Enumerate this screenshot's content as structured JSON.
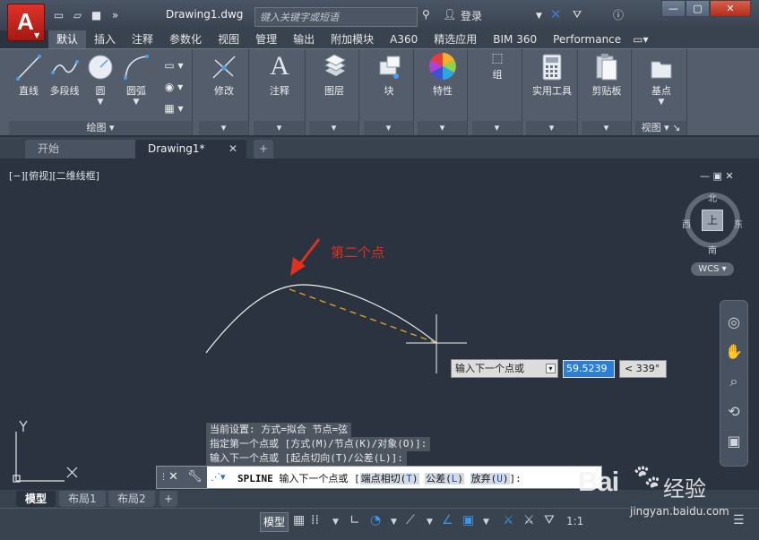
{
  "titlebar": {
    "document_title": "Drawing1.dwg",
    "search_placeholder": "键入关键字或短语",
    "signin_label": "登录"
  },
  "ribbon_tabs": [
    "默认",
    "插入",
    "注释",
    "参数化",
    "视图",
    "管理",
    "输出",
    "附加模块",
    "A360",
    "精选应用",
    "BIM 360",
    "Performance"
  ],
  "draw_panel": {
    "footer": "绘图",
    "tools": {
      "line": "直线",
      "polyline": "多段线",
      "circle": "圆",
      "arc": "圆弧"
    }
  },
  "panels": {
    "modify": "修改",
    "annotation": "注释",
    "layers": "图层",
    "block": "块",
    "properties": "特性",
    "groups": "组",
    "utilities": "实用工具",
    "clipboard": "剪贴板",
    "view": "视图",
    "basepoint": "基点"
  },
  "file_tabs": {
    "start": "开始",
    "drawing": "Drawing1*"
  },
  "viewport": {
    "label": "[−][俯视][二维线框]",
    "viewcube": {
      "face": "上",
      "north": "北",
      "south": "南",
      "east": "东",
      "west": "西"
    },
    "wcs": "WCS",
    "annotation_text": "第二个点"
  },
  "dynamic_input": {
    "prompt": "输入下一个点或",
    "distance_value": "59.5239",
    "angle_value": "< 339°"
  },
  "command_history": [
    "当前设置: 方式=拟合   节点=弦",
    "指定第一个点或 [方式(M)/节点(K)/对象(O)]:",
    "输入下一个点或 [起点切向(T)/公差(L)]:"
  ],
  "command_line": {
    "command": "SPLINE",
    "prompt": "输入下一个点或",
    "options": [
      {
        "label": "端点相切",
        "key": "T"
      },
      {
        "label": "公差",
        "key": "L"
      },
      {
        "label": "放弃",
        "key": "U"
      }
    ]
  },
  "layout_tabs": [
    "模型",
    "布局1",
    "布局2"
  ],
  "statusbar": {
    "model_button": "模型",
    "scale": "1:1"
  },
  "watermark": {
    "logo": "Bai",
    "text": "经验",
    "url": "jingyan.baidu.com"
  },
  "colors": {
    "canvas": "#2b3240",
    "ribbon": "#535d6b",
    "accent_red": "#e0301e",
    "rubberband": "#e2a52a"
  }
}
